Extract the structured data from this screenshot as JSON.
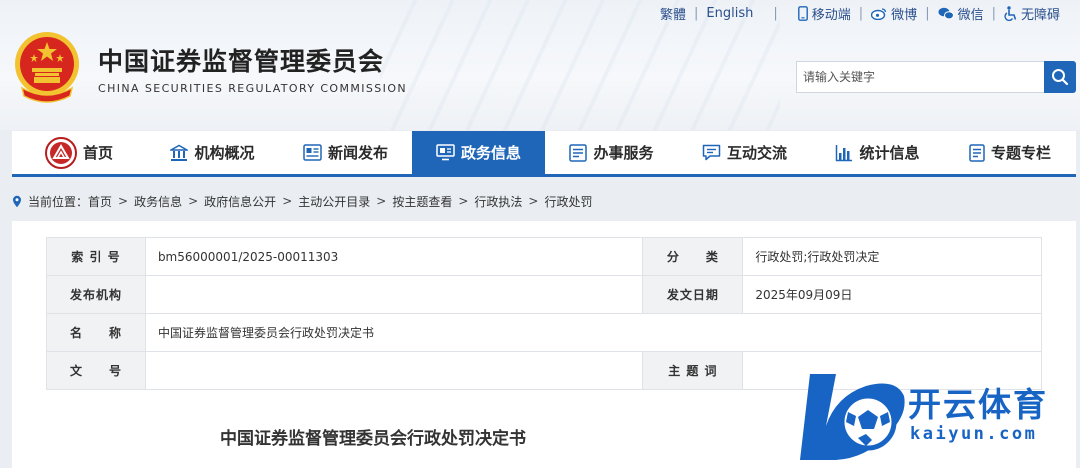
{
  "header": {
    "org_cn": "中国证券监督管理委员会",
    "org_en": "CHINA SECURITIES REGULATORY COMMISSION",
    "emblem_icon": "national-emblem-icon",
    "top_links": {
      "traditional": "繁體",
      "english": "English",
      "mobile": "移动端",
      "weibo": "微博",
      "wechat": "微信",
      "accessible": "无障碍"
    },
    "search": {
      "placeholder": "请输入关键字",
      "icon": "search-icon"
    }
  },
  "nav": {
    "items": [
      {
        "label": "首页",
        "icon": "home-logo-icon"
      },
      {
        "label": "机构概况",
        "icon": "building-icon"
      },
      {
        "label": "新闻发布",
        "icon": "news-icon"
      },
      {
        "label": "政务信息",
        "icon": "monitor-icon"
      },
      {
        "label": "办事服务",
        "icon": "list-icon"
      },
      {
        "label": "互动交流",
        "icon": "chat-icon"
      },
      {
        "label": "统计信息",
        "icon": "bar-chart-icon"
      },
      {
        "label": "专题专栏",
        "icon": "document-icon"
      }
    ],
    "active_index": 3
  },
  "breadcrumb": {
    "prefix": "当前位置：",
    "items": [
      "首页",
      "政务信息",
      "政府信息公开",
      "主动公开目录",
      "按主题查看",
      "行政执法",
      "行政处罚"
    ]
  },
  "meta": {
    "index_label": "索 引 号",
    "index_value": "bm56000001/2025-00011303",
    "category_label": "分　　类",
    "category_value": "行政处罚;行政处罚决定",
    "publisher_label": "发布机构",
    "publisher_value": "",
    "date_label": "发文日期",
    "date_value": "2025年09月09日",
    "name_label": "名　　称",
    "name_value": "中国证券监督管理委员会行政处罚决定书",
    "docno_label": "文　　号",
    "docno_value": "",
    "subject_label": "主 题 词",
    "subject_value": ""
  },
  "document": {
    "title": "中国证券监督管理委员会行政处罚决定书"
  },
  "watermark": {
    "cn": "开云体育",
    "en": "kaiyun.com"
  },
  "colors": {
    "accent": "#1f66b8",
    "emblem_red": "#d7261e",
    "emblem_gold": "#f2c230"
  }
}
